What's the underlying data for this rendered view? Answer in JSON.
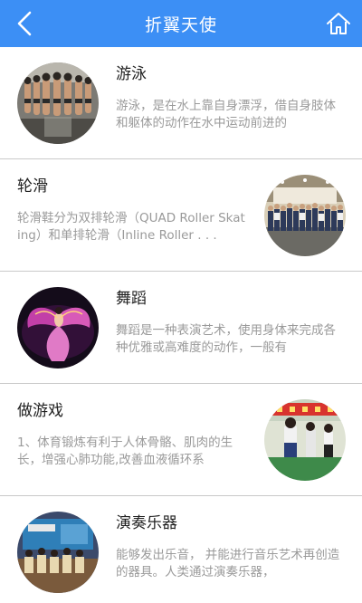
{
  "header": {
    "title": "折翼天使",
    "bg_color": "#3c8ff5",
    "back_icon": "chevron-left-icon",
    "home_icon": "home-icon"
  },
  "items": [
    {
      "title": "游泳",
      "desc": "游泳，是在水上靠自身漂浮，借自身肢体和躯体的动作在水中运动前进的",
      "image": "swimmers-photo"
    },
    {
      "title": "轮滑",
      "desc": "轮滑鞋分为双排轮滑（QUAD Roller Skating）和单排轮滑（Inline Roller . . .",
      "image": "group-photo"
    },
    {
      "title": "舞蹈",
      "desc": "舞蹈是一种表演艺术，使用身体来完成各种优雅或高难度的动作，一般有",
      "image": "dancer-photo"
    },
    {
      "title": "做游戏",
      "desc": "1、体育锻炼有利于人体骨骼、肌肉的生长，增强心肺功能,改善血液循环系",
      "image": "children-game-photo"
    },
    {
      "title": "演奏乐器",
      "desc": "能够发出乐音， 并能进行音乐艺术再创造的器具。人类通过演奏乐器，",
      "image": "orchestra-photo"
    }
  ]
}
